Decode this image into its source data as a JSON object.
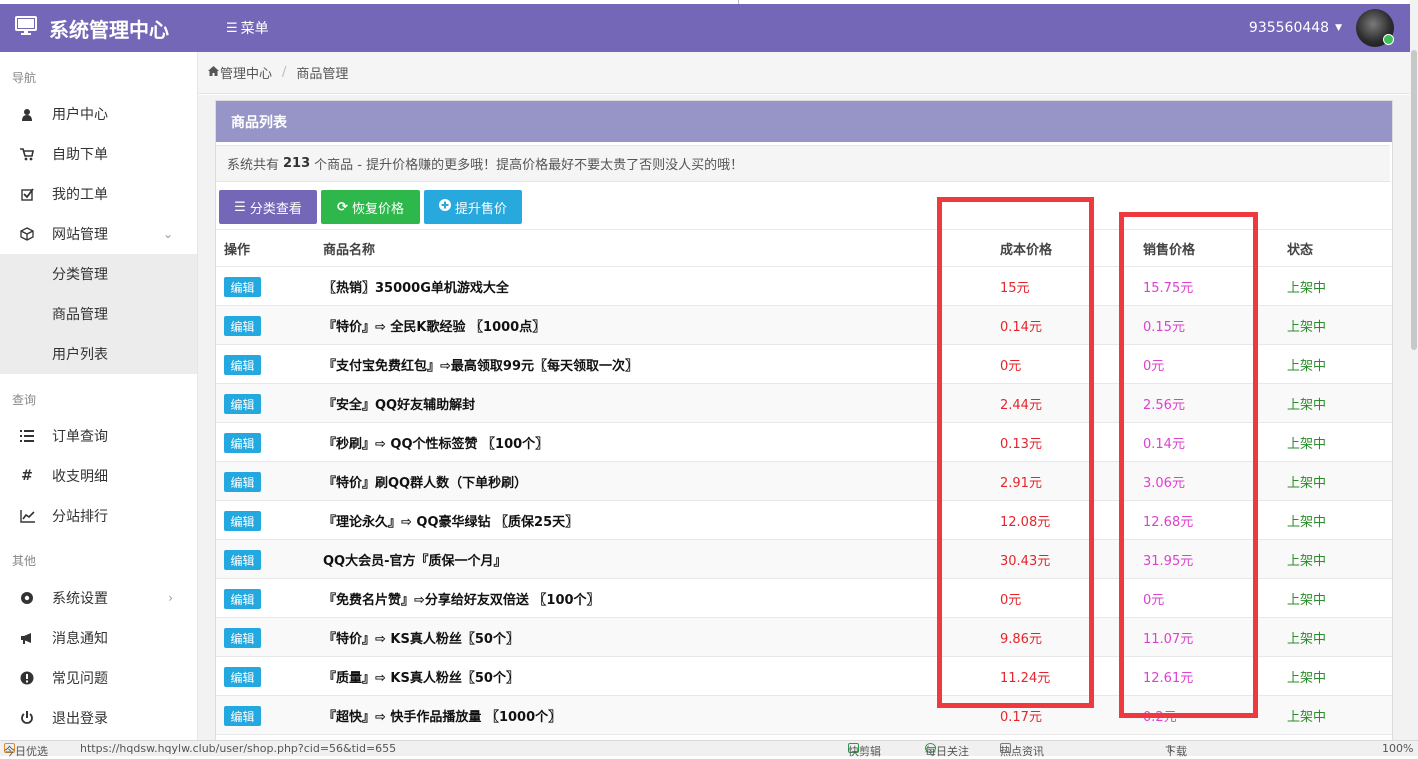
{
  "header": {
    "brand": "系统管理中心",
    "menu_label": "菜单",
    "username": "935560448",
    "colors": {
      "header_bg": "#7467b7",
      "panel_head_bg": "#9795c8"
    }
  },
  "sidebar": {
    "sections": [
      {
        "title": "导航",
        "items": [
          {
            "label": "用户中心",
            "icon": "user-icon"
          },
          {
            "label": "自助下单",
            "icon": "cart-icon"
          },
          {
            "label": "我的工单",
            "icon": "checkbox-icon"
          },
          {
            "label": "网站管理",
            "icon": "cube-icon",
            "expanded": true,
            "children": [
              "分类管理",
              "商品管理",
              "用户列表"
            ]
          }
        ]
      },
      {
        "title": "查询",
        "items": [
          {
            "label": "订单查询",
            "icon": "list-icon"
          },
          {
            "label": "收支明细",
            "icon": "hash-icon"
          },
          {
            "label": "分站排行",
            "icon": "line-chart-icon"
          }
        ]
      },
      {
        "title": "其他",
        "items": [
          {
            "label": "系统设置",
            "icon": "settings-icon"
          },
          {
            "label": "消息通知",
            "icon": "bullhorn-icon"
          },
          {
            "label": "常见问题",
            "icon": "exclamation-icon"
          },
          {
            "label": "退出登录",
            "icon": "power-icon"
          }
        ]
      }
    ]
  },
  "breadcrumb": {
    "home": "管理中心",
    "current": "商品管理"
  },
  "panel": {
    "title": "商品列表",
    "notice_prefix": "系统共有",
    "notice_count": "213",
    "notice_suffix": "个商品 - 提升价格赚的更多哦！提高价格最好不要太贵了否则没人买的哦！",
    "buttons": {
      "category": "分类查看",
      "restore": "恢复价格",
      "raise": "提升售价"
    },
    "columns": {
      "action": "操作",
      "name": "商品名称",
      "cost": "成本价格",
      "sale": "销售价格",
      "status": "状态"
    },
    "edit_label": "编辑",
    "rows": [
      {
        "name": "〖热销〗35000G单机游戏大全",
        "cost": "15元",
        "sale": "15.75元",
        "status": "上架中"
      },
      {
        "name": "『特价』⇨ 全民K歌经验 〖1000点〗",
        "cost": "0.14元",
        "sale": "0.15元",
        "status": "上架中"
      },
      {
        "name": "『支付宝免费红包』⇨最高领取99元〖每天领取一次〗",
        "cost": "0元",
        "sale": "0元",
        "status": "上架中"
      },
      {
        "name": "『安全』QQ好友辅助解封",
        "cost": "2.44元",
        "sale": "2.56元",
        "status": "上架中"
      },
      {
        "name": "『秒刷』⇨ QQ个性标签赞 〖100个〗",
        "cost": "0.13元",
        "sale": "0.14元",
        "status": "上架中"
      },
      {
        "name": "『特价』刷QQ群人数（下单秒刷）",
        "cost": "2.91元",
        "sale": "3.06元",
        "status": "上架中"
      },
      {
        "name": "『理论永久』⇨ QQ豪华绿钻 〖质保25天〗",
        "cost": "12.08元",
        "sale": "12.68元",
        "status": "上架中"
      },
      {
        "name": "QQ大会员-官方『质保一个月』",
        "cost": "30.43元",
        "sale": "31.95元",
        "status": "上架中"
      },
      {
        "name": "『免费名片赞』⇨分享给好友双倍送 〖100个〗",
        "cost": "0元",
        "sale": "0元",
        "status": "上架中"
      },
      {
        "name": "『特价』⇨ KS真人粉丝〖50个〗",
        "cost": "9.86元",
        "sale": "11.07元",
        "status": "上架中"
      },
      {
        "name": "『质量』⇨ KS真人粉丝〖50个〗",
        "cost": "11.24元",
        "sale": "12.61元",
        "status": "上架中"
      },
      {
        "name": "『超快』⇨ 快手作品播放量 〖1000个〗",
        "cost": "0.17元",
        "sale": "0.2元",
        "status": "上架中"
      }
    ]
  },
  "statusbar": {
    "left": "今日优选",
    "url": "https://hqdsw.hqylw.club/user/shop.php?cid=56&tid=655",
    "items": [
      "快剪辑",
      "每日关注",
      "热点资讯",
      "下载"
    ],
    "zoom": "100%"
  }
}
